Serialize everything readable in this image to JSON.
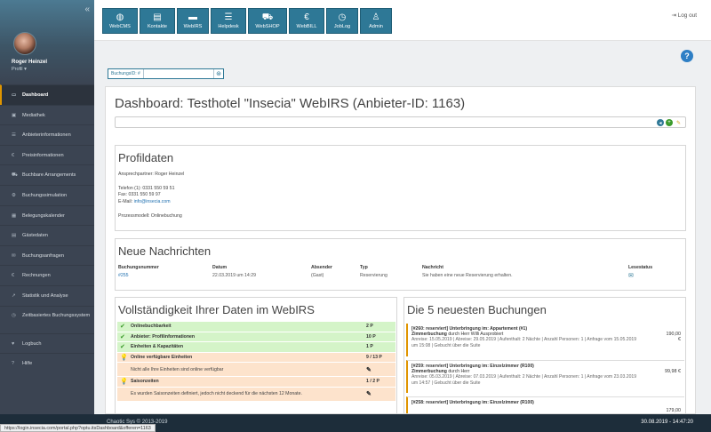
{
  "sidebar": {
    "collapse_icon": "double-chevron-left-icon",
    "user_name": "Roger Heinzel",
    "profile_label": "Profil",
    "items": [
      {
        "label": "Dashboard",
        "icon": "monitor-icon",
        "active": true
      },
      {
        "label": "Mediathek",
        "icon": "image-icon"
      },
      {
        "label": "Anbieterinformationen",
        "icon": "list-icon"
      },
      {
        "label": "Preisinformationen",
        "icon": "euro-icon"
      },
      {
        "label": "Buchbare Arrangements",
        "icon": "cart-icon"
      },
      {
        "label": "Buchungssimulation",
        "icon": "gear-icon"
      },
      {
        "label": "Belegungskalender",
        "icon": "calendar-icon"
      },
      {
        "label": "Gästedaten",
        "icon": "table-icon"
      },
      {
        "label": "Buchungsanfragen",
        "icon": "chat-icon"
      },
      {
        "label": "Rechnungen",
        "icon": "euro-icon"
      },
      {
        "label": "Statistik und Analyse",
        "icon": "chart-icon"
      },
      {
        "label": "Zeitbasiertes Buchungssystem",
        "icon": "clock-icon"
      },
      {
        "label": "Logbuch",
        "icon": "heart-icon"
      },
      {
        "label": "Hilfe",
        "icon": "question-icon"
      }
    ]
  },
  "modules": [
    {
      "label": "WebCMS",
      "icon": "globe-icon"
    },
    {
      "label": "Kontakte",
      "icon": "contact-card-icon"
    },
    {
      "label": "WebIRS",
      "icon": "bed-icon"
    },
    {
      "label": "Helpdesk",
      "icon": "list-icon"
    },
    {
      "label": "WebSHOP",
      "icon": "cart-icon"
    },
    {
      "label": "WebBILL",
      "icon": "euro-icon"
    },
    {
      "label": "JobLog",
      "icon": "clock-icon"
    },
    {
      "label": "Admin",
      "icon": "user-icon"
    }
  ],
  "logout_label": "Log out",
  "help_label": "?",
  "booking_search": {
    "label": "BuchungsID: #",
    "value": ""
  },
  "page_title": "Dashboard: Testhotel \"Insecia\" WebIRS (Anbieter-ID: 1163)",
  "profile": {
    "title": "Profildaten",
    "contact": "Ansprechpartner: Roger Heinzel",
    "phone": "Telefon (1): 0331 550 59 51",
    "fax": "Fax: 0331 550 59 97",
    "email_label": "E-Mail:",
    "email": "info@insecia.com",
    "process": "Prozessmodell: Onlinebuchung"
  },
  "messages": {
    "title": "Neue Nachrichten",
    "headers": [
      "Buchungsnummer",
      "Datum",
      "Absender",
      "Typ",
      "Nachricht",
      "Lesestatus"
    ],
    "rows": [
      {
        "number": "#255",
        "date": "22.03.2019 um 14:29",
        "sender": "(Gast)",
        "type": "Reservierung",
        "message": "Sie haben eine neue Reservierung erhalten.",
        "status_icon": "envelope-icon"
      }
    ]
  },
  "completeness": {
    "title": "Vollständigkeit Ihrer Daten im WebIRS",
    "rows": [
      {
        "label": "Onlinebuchbarkeit",
        "value": "2 P",
        "status": "ok"
      },
      {
        "label": "Anbieter: Profilinformationen",
        "value": "10 P",
        "status": "ok"
      },
      {
        "label": "Einheiten & Kapazitäten",
        "value": "1 P",
        "status": "ok"
      },
      {
        "label": "Online verfügbare Einheiten",
        "value": "9 / 13 P",
        "status": "warn"
      },
      {
        "label": "Nicht alle Ihre Einheiten sind online verfügbar",
        "value": "",
        "status": "note"
      },
      {
        "label": "Saisonzeiten",
        "value": "1 / 2 P",
        "status": "warn"
      },
      {
        "label": "Es wurden Saisonzeiten definiert, jedoch nicht deckend für die nächsten 12 Monate.",
        "value": "",
        "status": "note"
      }
    ]
  },
  "bookings": {
    "title": "Die 5 neuesten Buchungen",
    "items": [
      {
        "title": "[#260: reserviert] Unterbringung im: Appartement (#1)",
        "type": "Zimmerbuchung",
        "by": "durch Herr Willi Ausprobiert",
        "details": "Anreise: 15.05.2019 | Abreise: 29.05.2019 | Aufenthalt: 2 Nächte | Anzahl Personen: 1 | Anfrage vom 15.05.2019 um 15:08 | Gebucht über die Suite",
        "price": "190,00 €"
      },
      {
        "title": "[#259: reserviert] Unterbringung im: Einzelzimmer (R100)",
        "type": "Zimmerbuchung",
        "by": "durch Herr",
        "details": "Anreise: 05.03.2019 | Abreise: 07.03.2019 | Aufenthalt: 2 Nächte | Anzahl Personen: 1 | Anfrage vom 23.03.2019 um 14:57 | Gebucht über die Suite",
        "price": "99,98 €"
      },
      {
        "title": "[#258: reserviert] Unterbringung im: Einzelzimmer (R100)",
        "type": "",
        "by": "",
        "details": "",
        "price": "179,00"
      }
    ]
  },
  "footer": {
    "copyright": "Chaotic Sys © 2013-2019",
    "timestamp": "30.08.2019 - 14:47:20"
  },
  "status_url": "https://login.insecia.com/portal.php?optu.itsDashboard&offeren=1163"
}
